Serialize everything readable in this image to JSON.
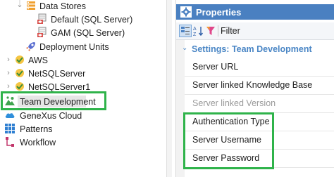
{
  "tree": {
    "items": [
      {
        "label": "Data Stores",
        "icon": "data-stores-icon"
      },
      {
        "label": "Default (SQL Server)",
        "icon": "database-icon"
      },
      {
        "label": "GAM (SQL Server)",
        "icon": "database-icon"
      },
      {
        "label": "Deployment Units",
        "icon": "rocket-icon"
      },
      {
        "label": "AWS",
        "icon": "cloud-node-icon"
      },
      {
        "label": "NetSQLServer",
        "icon": "cloud-node-icon"
      },
      {
        "label": "NetSQLServer1",
        "icon": "cloud-node-icon"
      },
      {
        "label": "Team Development",
        "icon": "team-development-icon"
      },
      {
        "label": "GeneXus Cloud",
        "icon": "cloud-icon"
      },
      {
        "label": "Patterns",
        "icon": "patterns-icon"
      },
      {
        "label": "Workflow",
        "icon": "workflow-icon"
      }
    ],
    "highlight_color": "#2fb34a"
  },
  "properties": {
    "title": "Properties",
    "toolbar": {
      "filter_label": "Filter"
    },
    "category": "Settings: Team Development",
    "rows": [
      {
        "label": "Server URL",
        "disabled": false
      },
      {
        "label": "Server linked Knowledge Base",
        "disabled": false
      },
      {
        "label": "Server linked Version",
        "disabled": true
      },
      {
        "label": "Authentication Type",
        "disabled": false
      },
      {
        "label": "Server Username",
        "disabled": false
      },
      {
        "label": "Server Password",
        "disabled": false
      }
    ]
  }
}
